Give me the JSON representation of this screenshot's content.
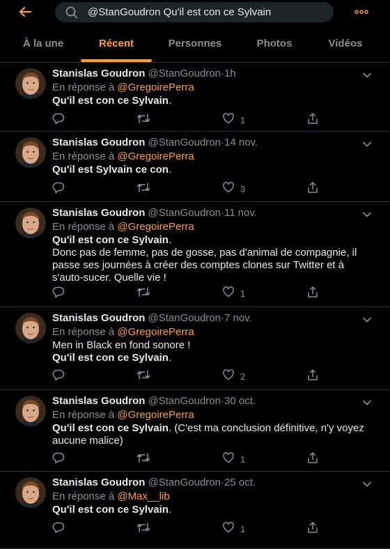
{
  "search": {
    "query": "@StanGoudron Qu'il est con ce Sylvain"
  },
  "tabs": [
    {
      "label": "À la une"
    },
    {
      "label": "Récent"
    },
    {
      "label": "Personnes"
    },
    {
      "label": "Photos"
    },
    {
      "label": "Vidéos"
    }
  ],
  "colors": {
    "accent": "#ff9d2e",
    "background": "#000000",
    "muted": "#8b8f94",
    "text": "#e7e9ea"
  },
  "tweets": [
    {
      "name": "Stanislas Goudron",
      "handle": "@StanGoudron",
      "dot": "·",
      "time": "1h",
      "reply_prefix": "En réponse à",
      "reply_to": "@GregoirePerra",
      "bold": "Qu'il est con ce Sylvain",
      "rest": ".",
      "extra": "",
      "likes": "1"
    },
    {
      "name": "Stanislas Goudron",
      "handle": "@StanGoudron",
      "dot": "·",
      "time": "14 nov.",
      "reply_prefix": "En réponse à",
      "reply_to": "@GregoirePerra",
      "bold": "Qu'il est Sylvain ce con",
      "rest": ".",
      "extra": "",
      "likes": "3"
    },
    {
      "name": "Stanislas Goudron",
      "handle": "@StanGoudron",
      "dot": "·",
      "time": "11 nov.",
      "reply_prefix": "En réponse à",
      "reply_to": "@GregoirePerra",
      "bold": "Qu'il est con ce Sylvain",
      "rest": ".",
      "extra": "Donc pas de femme, pas de gosse, pas d'animal de compagnie, il passe ses journées à créer des comptes clones sur Twitter et à s'auto-sucer. Quelle vie !",
      "likes": "1"
    },
    {
      "name": "Stanislas Goudron",
      "handle": "@StanGoudron",
      "dot": "·",
      "time": "7 nov.",
      "reply_prefix": "En réponse à",
      "reply_to": "@GregoirePerra",
      "pre": "Men in Black en fond sonore !",
      "bold": "Qu'il est con ce Sylvain",
      "rest": ".",
      "extra": "",
      "likes": "2"
    },
    {
      "name": "Stanislas Goudron",
      "handle": "@StanGoudron",
      "dot": "·",
      "time": "30 oct.",
      "reply_prefix": "En réponse à",
      "reply_to": "@GregoirePerra",
      "bold": "Qu'il est con ce Sylvain",
      "rest": ". (C'est ma conclusion définitive, n'y voyez aucune malice)",
      "extra": "",
      "likes": "1"
    },
    {
      "name": "Stanislas Goudron",
      "handle": "@StanGoudron",
      "dot": "·",
      "time": "25 oct.",
      "reply_prefix": "En réponse à",
      "reply_to": "@Max__lib",
      "bold": "Qu'il est con ce Sylvain",
      "rest": ".",
      "extra": "",
      "likes": "1"
    }
  ]
}
